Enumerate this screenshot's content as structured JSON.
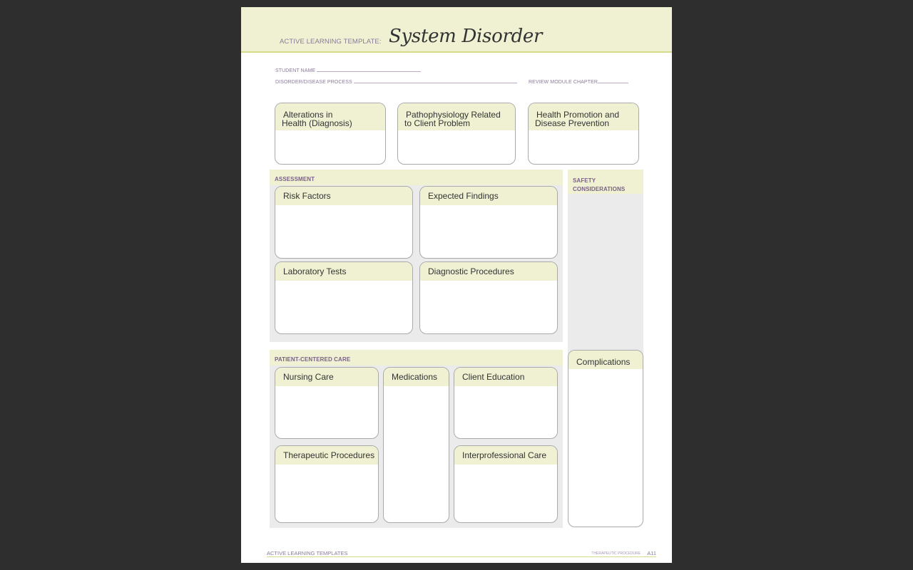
{
  "header": {
    "label": "ACTIVE LEARNING TEMPLATE:",
    "title": "System Disorder"
  },
  "fields": {
    "student_name": {
      "label": "STUDENT NAME",
      "value": ""
    },
    "disorder": {
      "label": "DISORDER/DISEASE PROCESS",
      "value": ""
    },
    "chapter": {
      "label": "REVIEW MODULE CHAPTER",
      "value": ""
    }
  },
  "top_boxes": [
    {
      "line1": "Alterations in",
      "line2": "Health (Diagnosis)"
    },
    {
      "line1": "Pathophysiology Related",
      "line2": "to Client Problem"
    },
    {
      "line1": "Health Promotion and",
      "line2": "Disease Prevention"
    }
  ],
  "assessment": {
    "label": "ASSESSMENT",
    "boxes": [
      "Risk Factors",
      "Expected Findings",
      "Laboratory Tests",
      "Diagnostic Procedures"
    ]
  },
  "safety": {
    "line1": "SAFETY",
    "line2": "CONSIDERATIONS"
  },
  "patient_care": {
    "label": "PATIENT-CENTERED CARE",
    "boxes": [
      "Nursing Care",
      "Medications",
      "Client Education",
      "Therapeutic Procedures",
      "Interprofessional Care"
    ]
  },
  "complications": {
    "label": "Complications"
  },
  "footer": {
    "left": "ACTIVE LEARNING TEMPLATES",
    "right": "THERAPEUTIC PROCEDURE",
    "page": "A11"
  },
  "colors": {
    "accent_band": "#eff1d2",
    "accent_line": "#d5dd8a",
    "label_purple": "#7b5f8a",
    "section_gray": "#ebebeb",
    "background": "#2e2e2e"
  }
}
